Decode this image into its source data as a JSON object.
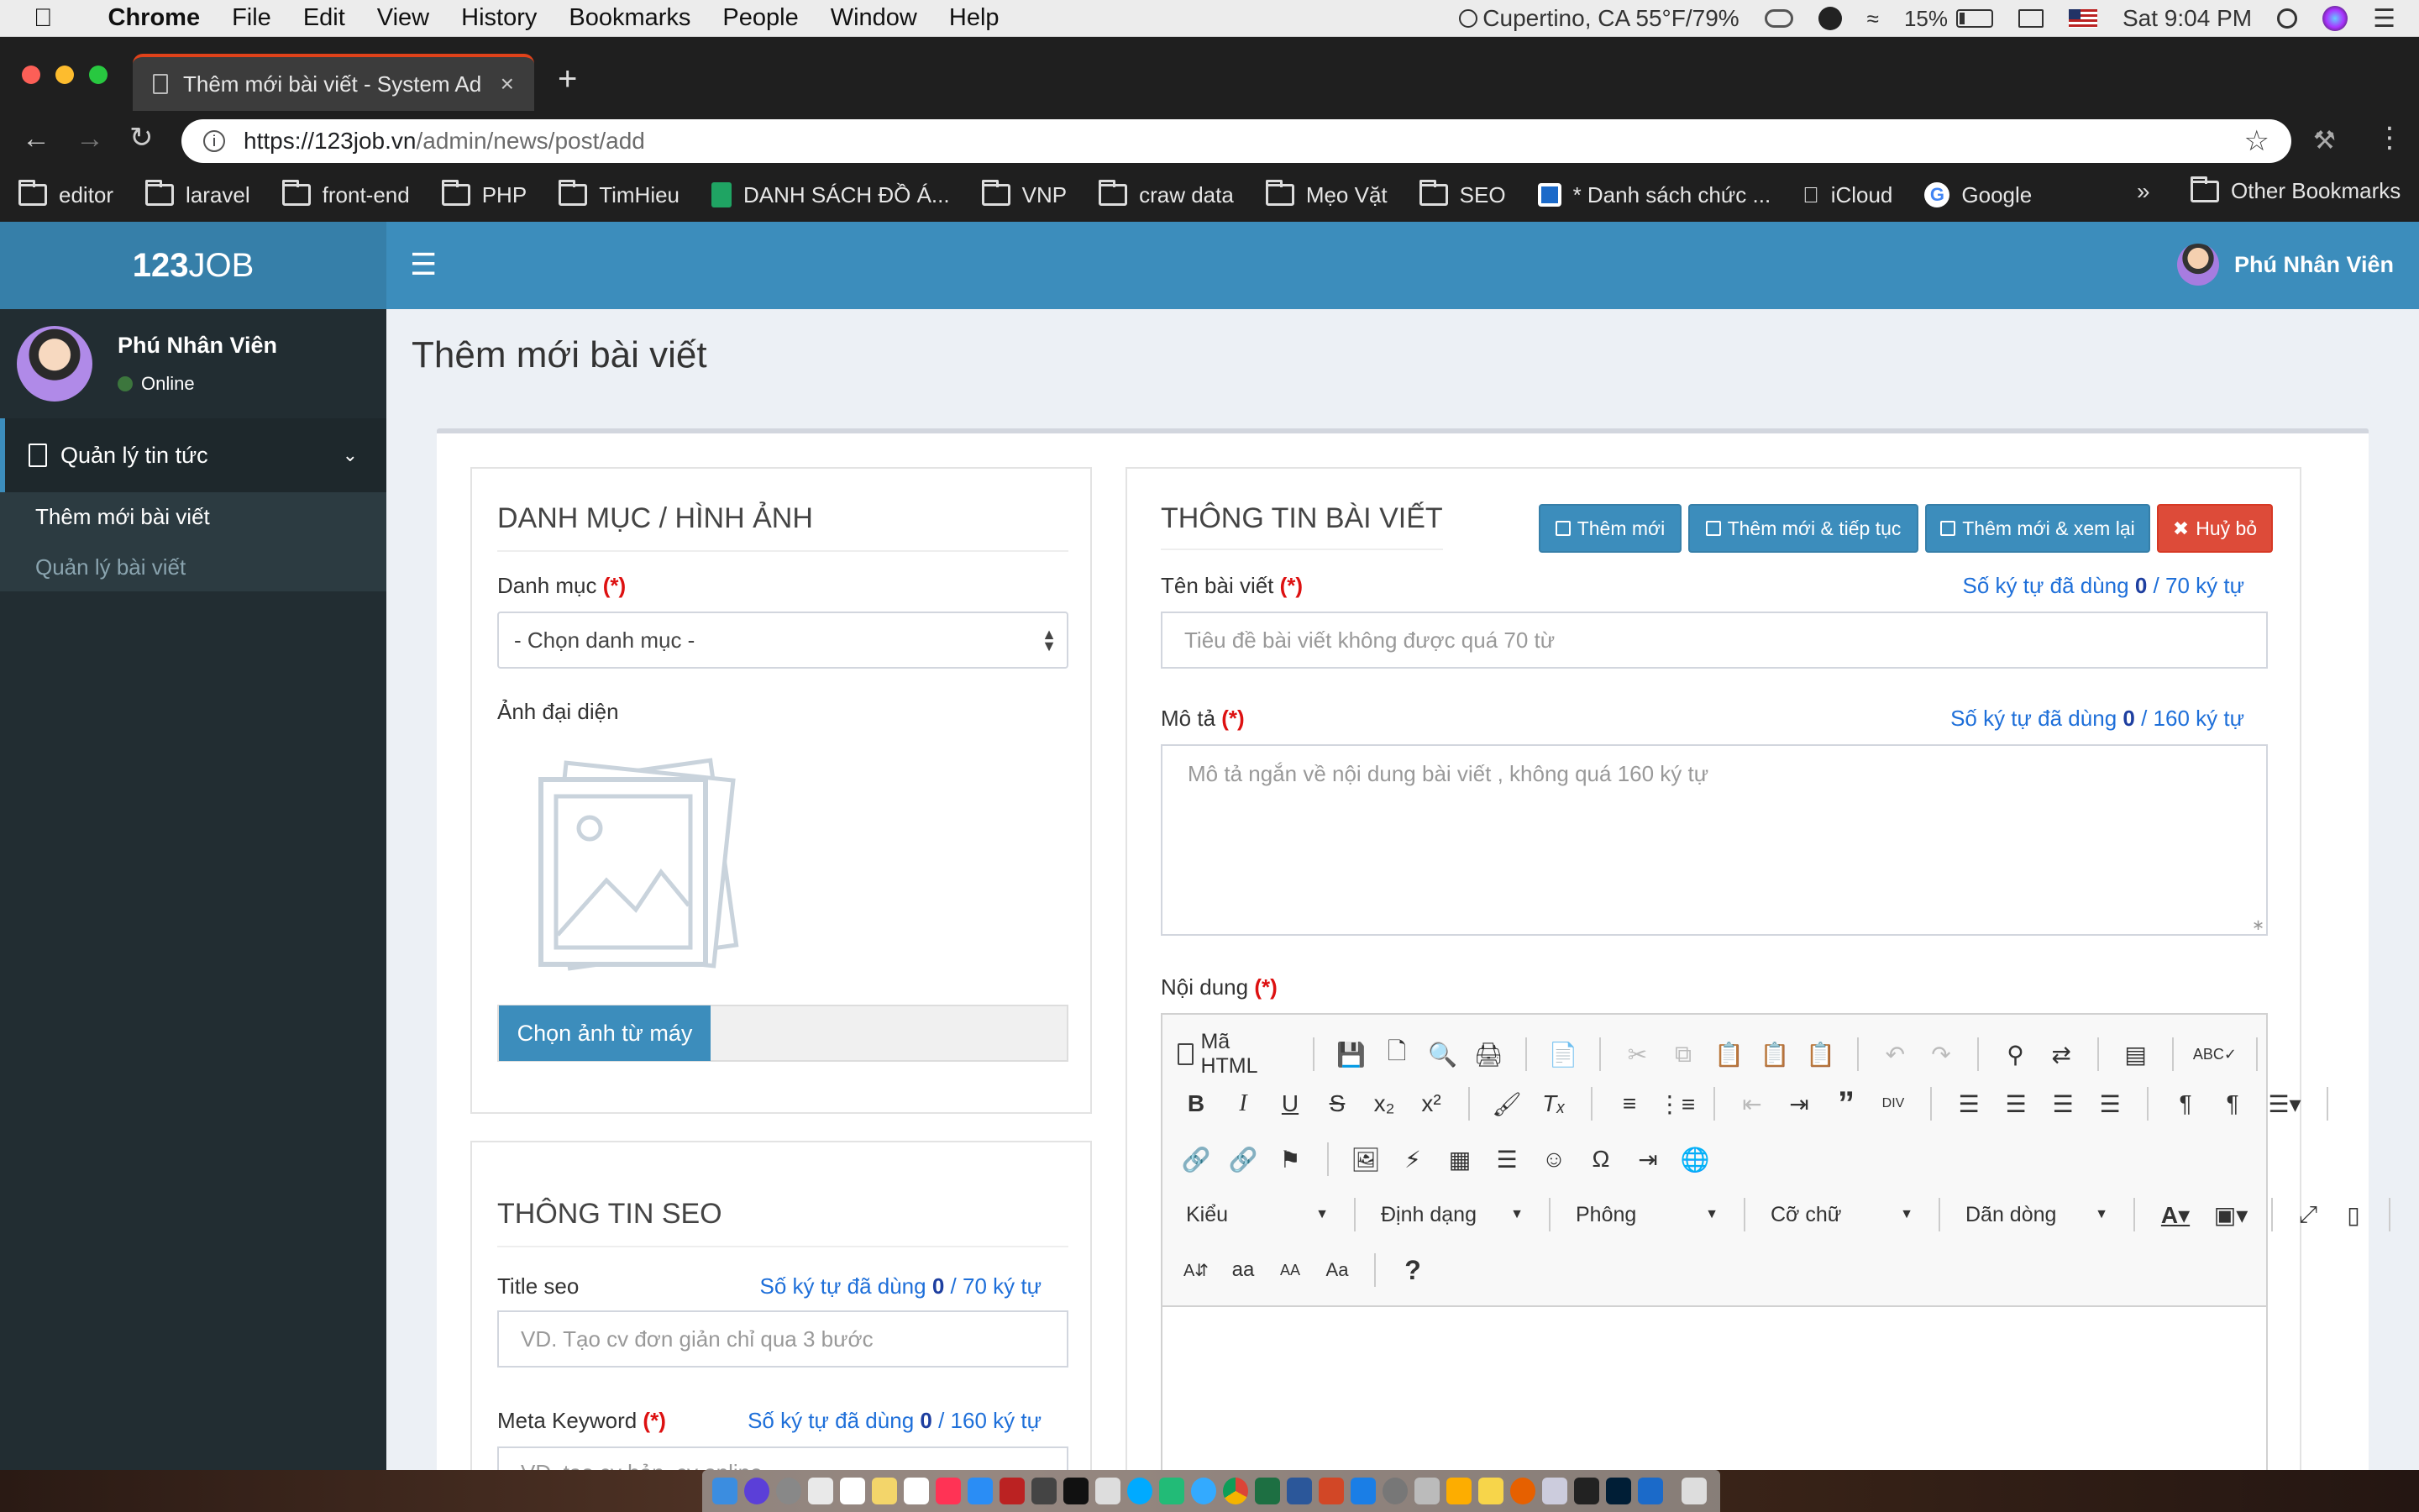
{
  "menubar": {
    "app_name": "Chrome",
    "items": [
      "File",
      "Edit",
      "View",
      "History",
      "Bookmarks",
      "People",
      "Window",
      "Help"
    ],
    "weather": "Cupertino, CA 55°F/79%",
    "battery": "15%",
    "clock": "Sat 9:04 PM"
  },
  "browser": {
    "tab_title": "Thêm mới bài viết - System Ad",
    "url_host": "https://123job.vn",
    "url_path": "/admin/news/post/add",
    "bookmarks": [
      "editor",
      "laravel",
      "front-end",
      "PHP",
      "TimHieu",
      "DANH SÁCH ĐỒ Á...",
      "VNP",
      "craw data",
      "Mẹo Vặt",
      "SEO",
      "* Danh sách chức ...",
      "iCloud",
      "Google"
    ],
    "more": "»",
    "other_bookmarks": "Other Bookmarks"
  },
  "header": {
    "logo_bold": "123",
    "logo_light": "JOB",
    "user_name": "Phú Nhân Viên"
  },
  "sidebar": {
    "user_name": "Phú Nhân Viên",
    "status": "Online",
    "menu_title": "Quản lý tin tức",
    "sub_items": [
      "Thêm mới bài viết",
      "Quản lý bài viết"
    ]
  },
  "page": {
    "title": "Thêm mới bài viết"
  },
  "left_panel": {
    "title": "DANH MỤC / HÌNH ẢNH",
    "category_label": "Danh mục",
    "required": "(*)",
    "category_value": "- Chọn danh mục -",
    "avatar_label": "Ảnh đại diện",
    "choose_image": "Chọn ảnh từ máy"
  },
  "seo_panel": {
    "title": "THÔNG TIN SEO",
    "title_seo_label": "Title seo",
    "title_seo_counter_pre": "Số ký tự đã dùng",
    "title_seo_count": "0",
    "title_seo_counter_post": "/ 70 ký tự",
    "title_seo_placeholder": "VD. Tạo cv đơn giản chỉ qua 3 bước",
    "meta_keyword_label": "Meta Keyword",
    "meta_keyword_counter_pre": "Số ký tự đã dùng",
    "meta_keyword_count": "0",
    "meta_keyword_counter_post": "/ 160 ký tự",
    "meta_keyword_placeholder": "VD. tạo cv bản, cv online"
  },
  "right_panel": {
    "title": "THÔNG TIN BÀI VIẾT",
    "buttons": {
      "add": "Thêm mới",
      "add_continue": "Thêm mới & tiếp tục",
      "add_review": "Thêm mới & xem lại",
      "cancel": "Huỷ bỏ"
    },
    "name_label": "Tên bài viết",
    "name_counter_pre": "Số ký tự đã dùng",
    "name_count": "0",
    "name_counter_post": "/ 70 ký tự",
    "name_placeholder": "Tiêu đề bài viết không được quá 70 từ",
    "desc_label": "Mô tả",
    "desc_counter_pre": "Số ký tự đã dùng",
    "desc_count": "0",
    "desc_counter_post": "/ 160 ký tự",
    "desc_placeholder": "Mô tả ngắn về nội dung bài viết , không quá 160 ký tự",
    "content_label": "Nội dung"
  },
  "editor": {
    "source_label": "Mã HTML",
    "style_combo": "Kiểu",
    "format_combo": "Định dạng",
    "font_combo": "Phông",
    "size_combo": "Cỡ chữ",
    "lineheight_combo": "Dãn dòng",
    "help": "?"
  },
  "colors": {
    "primary": "#3c8dbc",
    "danger": "#dd4b39",
    "sidebar": "#222d32",
    "required": "#dd1111"
  }
}
